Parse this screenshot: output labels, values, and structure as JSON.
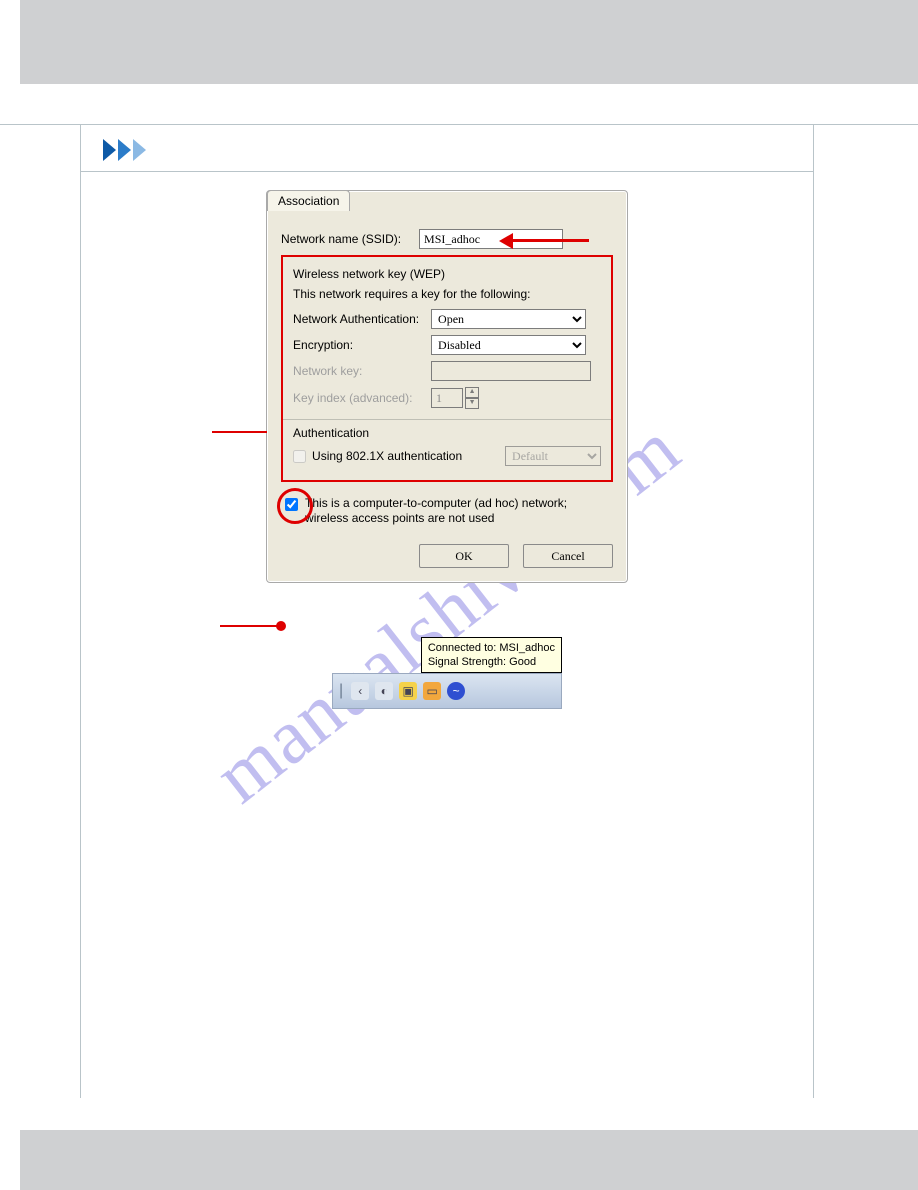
{
  "watermark": "manualshive.com",
  "dialog": {
    "tab": "Association",
    "ssid_label": "Network name (SSID):",
    "ssid_value": "MSI_adhoc",
    "wep_group": "Wireless network key (WEP)",
    "wep_desc": "This network requires a key for the following:",
    "auth_label": "Network Authentication:",
    "auth_value": "Open",
    "enc_label": "Encryption:",
    "enc_value": "Disabled",
    "netkey_label": "Network key:",
    "keyidx_label": "Key index (advanced):",
    "keyidx_value": "1",
    "auth_group": "Authentication",
    "auth8021x_label": "Using 802.1X authentication",
    "auth8021x_value": "Default",
    "adhoc_label": "This is a computer-to-computer (ad hoc) network; wireless access points are not used",
    "ok": "OK",
    "cancel": "Cancel"
  },
  "tray": {
    "tooltip_line1": "Connected to: MSI_adhoc",
    "tooltip_line2": "Signal Strength: Good"
  }
}
